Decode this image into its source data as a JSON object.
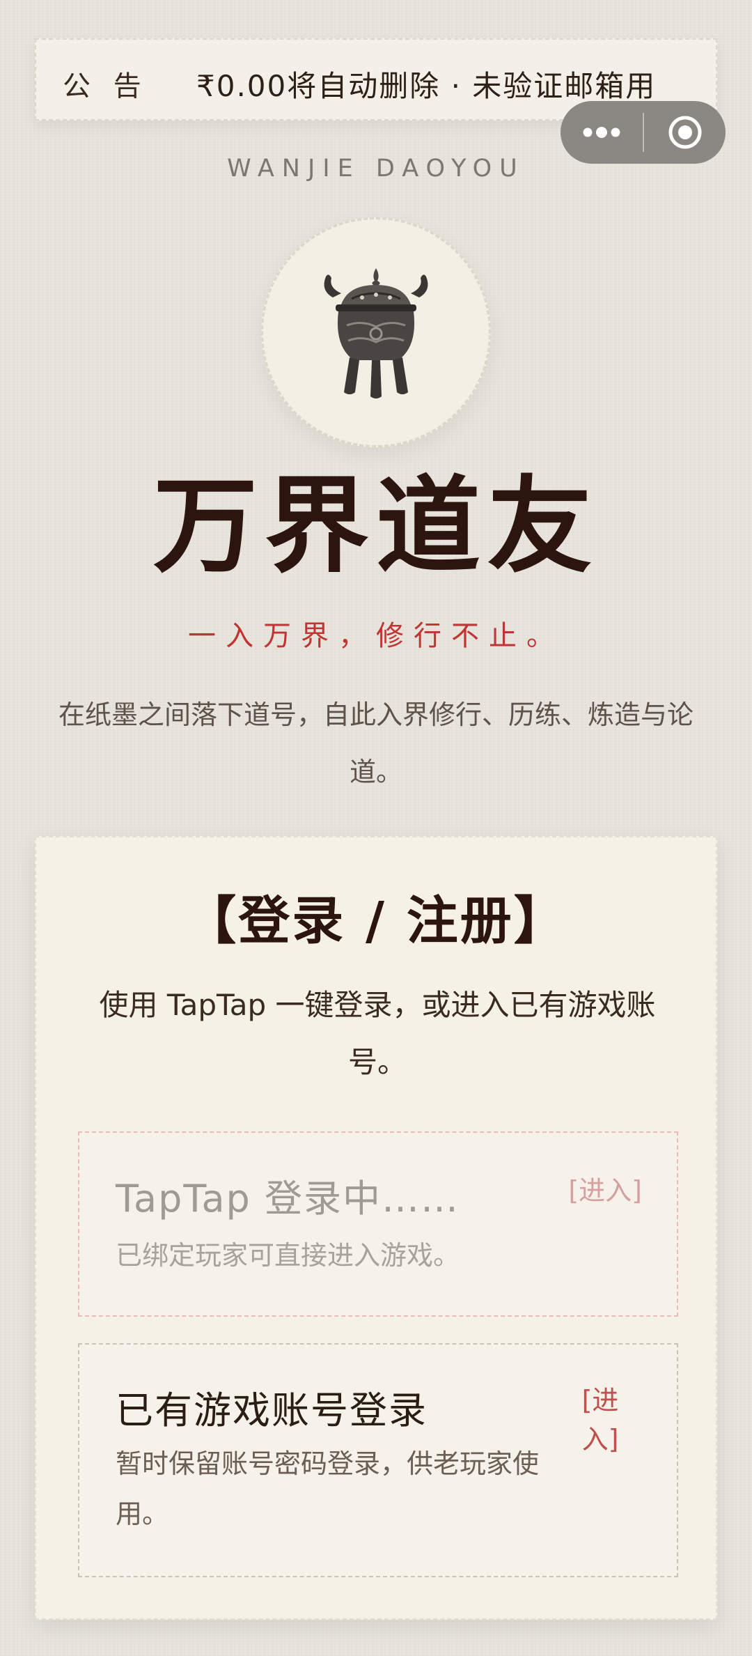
{
  "notice": {
    "label": "公 告",
    "ticker_text": "₹0.00将自动删除  ·  未验证邮箱用"
  },
  "miniprogram_capsule": {
    "more_icon": "more-dots-icon",
    "close_icon": "target-close-icon"
  },
  "brand": {
    "latin_name": "WANJIE DAOYOU",
    "emblem_icon": "incense-burner-icon",
    "title": "万界道友",
    "motto": "一入万界，修行不止。",
    "intro": "在纸墨之间落下道号，自此入界修行、历练、炼造与论道。"
  },
  "login_card": {
    "title": "【登录 / 注册】",
    "description": "使用 TapTap 一键登录，或进入已有游戏账号。",
    "options": [
      {
        "title": "TapTap 登录中……",
        "subtitle": "已绑定玩家可直接进入游戏。",
        "action": "[进入]"
      },
      {
        "title": "已有游戏账号登录",
        "subtitle": "暂时保留账号密码登录，供老玩家使用。",
        "action": "[进入]"
      }
    ]
  },
  "colors": {
    "background": "#e9e5dd",
    "ink": "#2c140f",
    "accent_red": "#c03434",
    "card_bg": "#f5f1e7"
  }
}
